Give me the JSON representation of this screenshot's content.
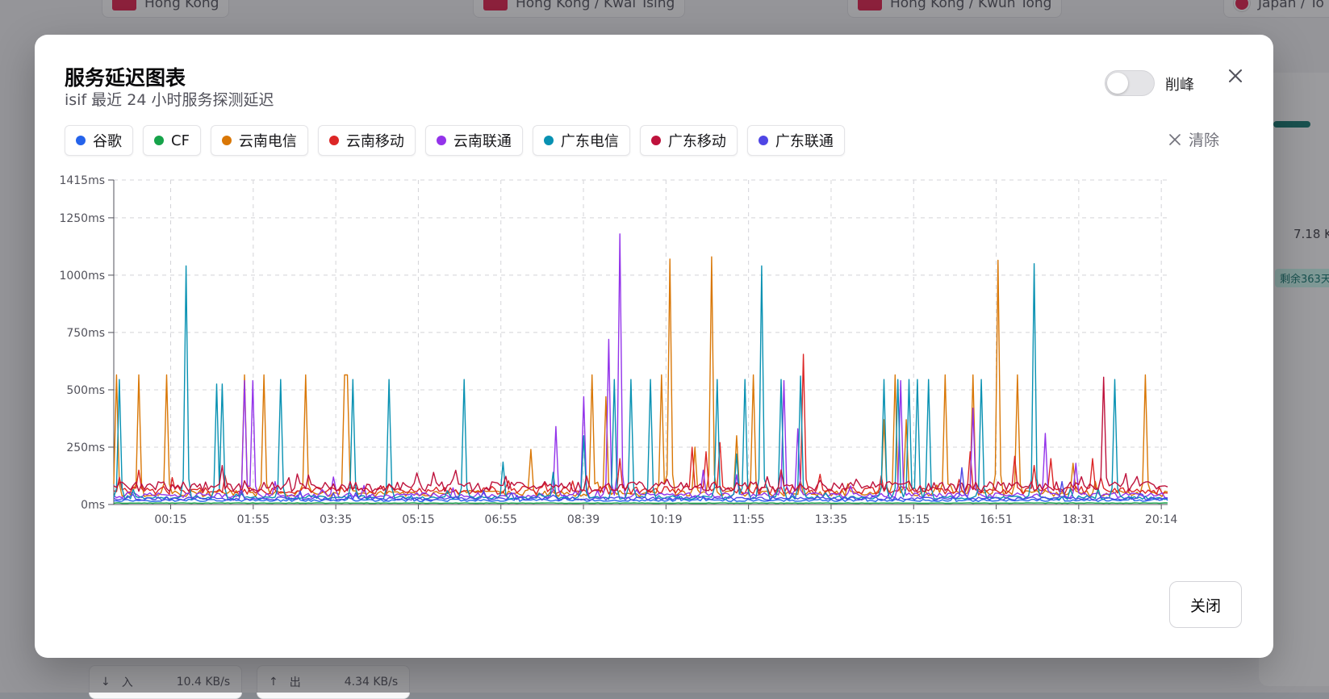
{
  "background": {
    "location_chips": [
      "Hong Kong",
      "Hong Kong / Kwai Tsing",
      "Hong Kong / Kwun Tong",
      "Japan / To"
    ],
    "traffic": [
      {
        "arrow": "↓",
        "label": "入",
        "value": "10.4 KB/s"
      },
      {
        "arrow": "↑",
        "label": "出",
        "value": "4.34 KB/s"
      }
    ],
    "right_value": "7.18 K",
    "right_badge": "剩余363天"
  },
  "modal": {
    "title": "服务延迟图表",
    "subtitle": "isif 最近 24 小时服务探测延迟",
    "toggle_label": "削峰",
    "toggle_on": false,
    "clear_label": "清除",
    "close_button_label": "关闭"
  },
  "chart_data": {
    "type": "line",
    "y_unit": "ms",
    "ylim": [
      0,
      1415
    ],
    "y_ticks": [
      0,
      250,
      500,
      750,
      1000,
      1250,
      1415
    ],
    "y_tick_labels": [
      "0ms",
      "250ms",
      "500ms",
      "750ms",
      "1000ms",
      "1250ms",
      "1415ms"
    ],
    "x_ticks": [
      "00:15",
      "01:55",
      "03:35",
      "05:15",
      "06:55",
      "08:39",
      "10:19",
      "11:55",
      "13:35",
      "15:15",
      "16:51",
      "18:31",
      "20:14"
    ],
    "grid": true,
    "legend_position": "top-left",
    "series": [
      {
        "name": "谷歌",
        "color": "#2563eb",
        "base": 18,
        "peaks": []
      },
      {
        "name": "CF",
        "color": "#16a34a",
        "base": 5,
        "peaks": []
      },
      {
        "name": "云南电信",
        "color": "#d97706",
        "base": 48,
        "peaks": [
          [
            0.003,
            565
          ],
          [
            0.023,
            565
          ],
          [
            0.051,
            565
          ],
          [
            0.124,
            565
          ],
          [
            0.142,
            565
          ],
          [
            0.183,
            565
          ],
          [
            0.218,
            565
          ],
          [
            0.222,
            565
          ],
          [
            0.396,
            240
          ],
          [
            0.454,
            565
          ],
          [
            0.468,
            470
          ],
          [
            0.519,
            565
          ],
          [
            0.529,
            1070
          ],
          [
            0.552,
            250
          ],
          [
            0.566,
            1080
          ],
          [
            0.59,
            300
          ],
          [
            0.606,
            565
          ],
          [
            0.73,
            370
          ],
          [
            0.742,
            565
          ],
          [
            0.751,
            370
          ],
          [
            0.79,
            565
          ],
          [
            0.815,
            565
          ],
          [
            0.839,
            1065
          ],
          [
            0.858,
            565
          ],
          [
            0.91,
            180
          ],
          [
            0.98,
            565
          ]
        ]
      },
      {
        "name": "云南移动",
        "color": "#dc2626",
        "base": 62,
        "peaks": [
          [
            0.025,
            150
          ],
          [
            0.48,
            200
          ],
          [
            0.55,
            250
          ],
          [
            0.563,
            230
          ],
          [
            0.575,
            270
          ],
          [
            0.655,
            655
          ],
          [
            0.813,
            230
          ],
          [
            0.856,
            210
          ],
          [
            0.873,
            170
          ],
          [
            0.89,
            200
          ],
          [
            0.93,
            200
          ]
        ]
      },
      {
        "name": "云南联通",
        "color": "#9333ea",
        "base": 40,
        "peaks": [
          [
            0.124,
            540
          ],
          [
            0.133,
            540
          ],
          [
            0.153,
            100
          ],
          [
            0.209,
            120
          ],
          [
            0.42,
            340
          ],
          [
            0.447,
            470
          ],
          [
            0.47,
            720
          ],
          [
            0.479,
            1180
          ],
          [
            0.559,
            150
          ],
          [
            0.59,
            130
          ],
          [
            0.637,
            540
          ],
          [
            0.65,
            330
          ],
          [
            0.748,
            540
          ],
          [
            0.816,
            420
          ],
          [
            0.884,
            310
          ],
          [
            0.914,
            180
          ]
        ]
      },
      {
        "name": "广东电信",
        "color": "#0891b2",
        "base": 30,
        "peaks": [
          [
            0.006,
            545
          ],
          [
            0.069,
            1040
          ],
          [
            0.098,
            525
          ],
          [
            0.104,
            525
          ],
          [
            0.158,
            545
          ],
          [
            0.228,
            545
          ],
          [
            0.26,
            545
          ],
          [
            0.332,
            545
          ],
          [
            0.37,
            185
          ],
          [
            0.418,
            140
          ],
          [
            0.447,
            300
          ],
          [
            0.475,
            545
          ],
          [
            0.49,
            545
          ],
          [
            0.51,
            545
          ],
          [
            0.573,
            545
          ],
          [
            0.59,
            220
          ],
          [
            0.598,
            545
          ],
          [
            0.614,
            1040
          ],
          [
            0.632,
            545
          ],
          [
            0.652,
            560
          ],
          [
            0.73,
            545
          ],
          [
            0.744,
            545
          ],
          [
            0.754,
            545
          ],
          [
            0.762,
            545
          ],
          [
            0.772,
            545
          ],
          [
            0.823,
            545
          ],
          [
            0.873,
            1050
          ],
          [
            0.95,
            545
          ]
        ]
      },
      {
        "name": "广东移动",
        "color": "#be123c",
        "base": 78,
        "peaks": [
          [
            0.035,
            90
          ],
          [
            0.41,
            100
          ],
          [
            0.526,
            110
          ],
          [
            0.67,
            105
          ],
          [
            0.705,
            110
          ],
          [
            0.94,
            555
          ],
          [
            0.97,
            110
          ]
        ]
      },
      {
        "name": "广东联通",
        "color": "#4f46e5",
        "base": 26,
        "peaks": [
          [
            0.35,
            60
          ],
          [
            0.805,
            160
          ],
          [
            0.9,
            100
          ]
        ]
      }
    ]
  }
}
